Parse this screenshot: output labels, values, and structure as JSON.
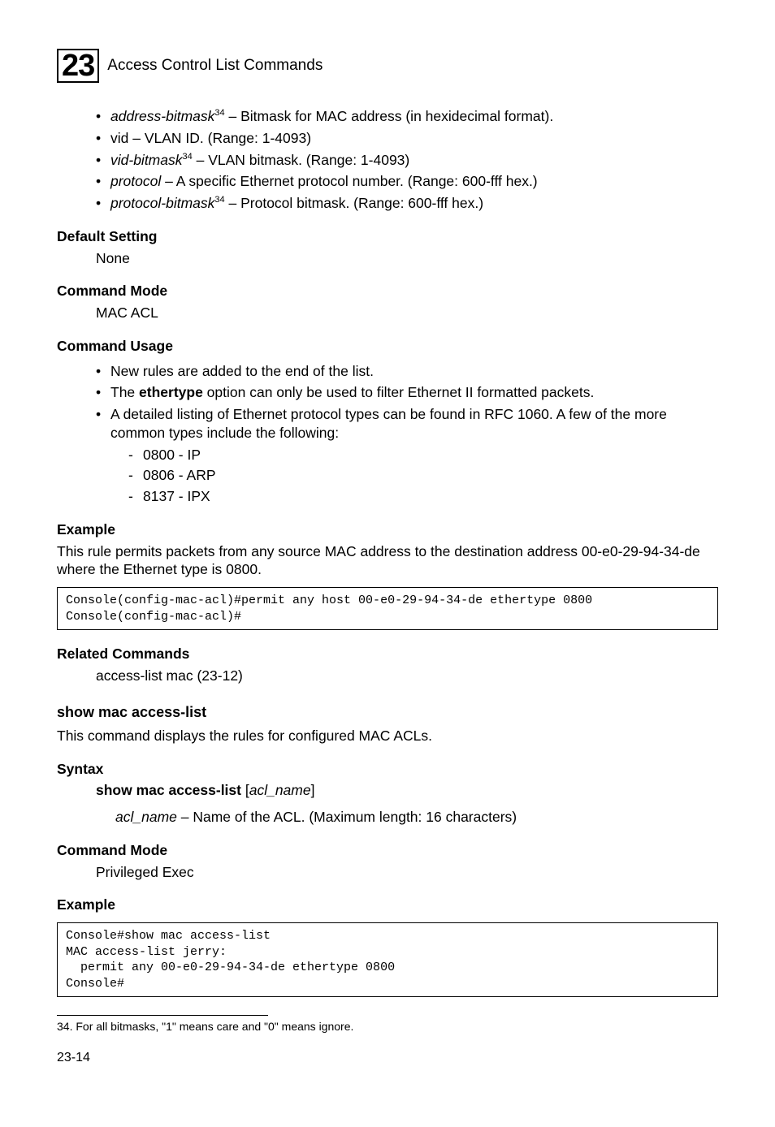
{
  "header": {
    "chapter_number": "23",
    "title": "Access Control List Commands"
  },
  "params": {
    "item1_pre": "address-bitmask",
    "item1_sup": "34",
    "item1_post": " – Bitmask for MAC address (in hexidecimal format).",
    "item2": "vid – VLAN ID. (Range: 1-4093)",
    "item3_pre": "vid-bitmask",
    "item3_sup": "34",
    "item3_post": " – VLAN bitmask. (Range: 1-4093)",
    "item4_pre": "protocol",
    "item4_post": " – A specific Ethernet protocol number. (Range: 600-fff hex.)",
    "item5_pre": "protocol-bitmask",
    "item5_sup": "34",
    "item5_post": " – Protocol bitmask. (Range: 600-fff hex.)"
  },
  "default_setting": {
    "heading": "Default Setting",
    "body": "None"
  },
  "command_mode1": {
    "heading": "Command Mode",
    "body": "MAC ACL"
  },
  "usage": {
    "heading": "Command Usage",
    "b1": "New rules are added to the end of the list.",
    "b2_pre": "The ",
    "b2_bold": "ethertype",
    "b2_post": " option can only be used to filter Ethernet II formatted packets.",
    "b3": "A detailed listing of Ethernet protocol types can be found in RFC 1060. A few of the more common types include the following:",
    "d1": "0800 - IP",
    "d2": "0806 - ARP",
    "d3": "8137 - IPX"
  },
  "example1": {
    "heading": "Example",
    "text": "This rule permits packets from any source MAC address to the destination address 00-e0-29-94-34-de where the Ethernet type is 0800.",
    "code": "Console(config-mac-acl)#permit any host 00-e0-29-94-34-de ethertype 0800\nConsole(config-mac-acl)#"
  },
  "related": {
    "heading": "Related Commands",
    "body": "access-list mac (23-12)"
  },
  "cmd": {
    "heading": "show mac access-list",
    "desc": "This command displays the rules for configured MAC ACLs.",
    "syntax_heading": "Syntax",
    "syntax_bold": "show mac access-list",
    "syntax_rest_pre": " [",
    "syntax_ital": "acl_name",
    "syntax_rest_post": "]",
    "param_ital": "acl_name",
    "param_rest": " – Name of the ACL. (Maximum length: 16 characters)"
  },
  "command_mode2": {
    "heading": "Command Mode",
    "body": "Privileged Exec"
  },
  "example2": {
    "heading": "Example",
    "code": "Console#show mac access-list\nMAC access-list jerry:\n  permit any 00-e0-29-94-34-de ethertype 0800\nConsole#"
  },
  "footnote": {
    "text": "34.  For all bitmasks, \"1\" means care and \"0\" means ignore."
  },
  "page_number": "23-14"
}
